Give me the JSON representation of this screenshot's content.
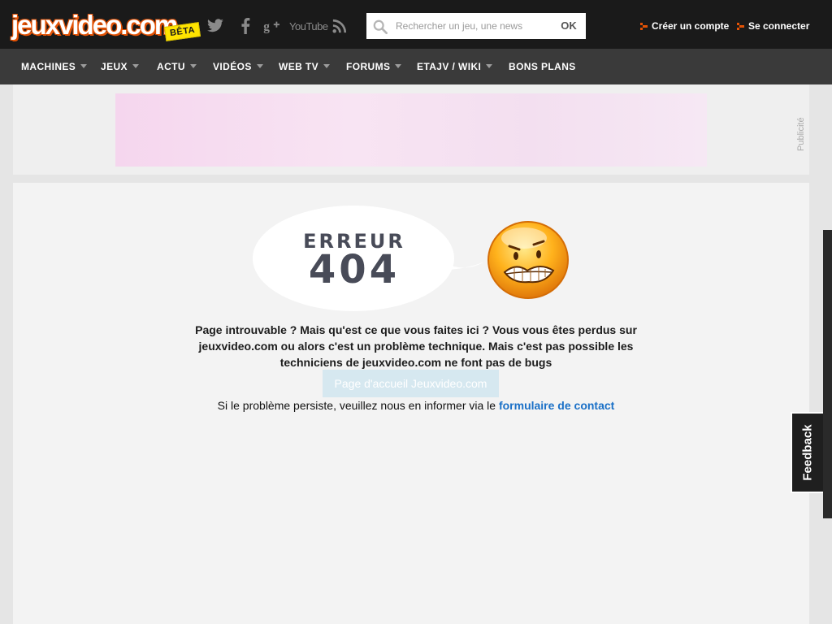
{
  "header": {
    "logo_text": "jeuxvideo.com",
    "beta_badge": "BÊTA",
    "social_icons": [
      "twitter-icon",
      "facebook-icon",
      "google-plus-icon",
      "youtube-icon",
      "rss-icon"
    ],
    "youtube_label": "YouTube",
    "search": {
      "placeholder": "Rechercher un jeu, une news",
      "button_label": "OK"
    },
    "create_account": "Créer un compte",
    "login": "Se connecter"
  },
  "nav": {
    "items": [
      {
        "label": "MACHINES",
        "has_dropdown": true
      },
      {
        "label": "JEUX",
        "has_dropdown": true
      },
      {
        "label": "ACTU",
        "has_dropdown": true
      },
      {
        "label": "VIDÉOS",
        "has_dropdown": true
      },
      {
        "label": "WEB TV",
        "has_dropdown": true
      },
      {
        "label": "FORUMS",
        "has_dropdown": true
      },
      {
        "label": "ETAJV / WIKI",
        "has_dropdown": true
      },
      {
        "label": "BONS PLANS",
        "has_dropdown": false
      }
    ]
  },
  "ad": {
    "label": "Publicité"
  },
  "error": {
    "word": "ERREUR",
    "code": "404",
    "message": "Page introuvable ? Mais qu'est ce que vous faites ici ? Vous vous êtes perdus sur jeuxvideo.com ou alors c'est un problème technique. Mais c'est pas possible les techniciens de jeuxvideo.com ne font pas de bugs",
    "home_button": "Page d'accueil Jeuxvideo.com",
    "persist_text": "Si le problème persiste, veuillez nous en informer via le ",
    "contact_link": "formulaire de contact"
  },
  "feedback": {
    "label": "Feedback"
  },
  "colors": {
    "topbar": "#1a1a1a",
    "nav": "#3a3a3a",
    "accent_orange": "#e35205",
    "link_blue": "#1a70c7",
    "beta_yellow": "#ffe400"
  }
}
